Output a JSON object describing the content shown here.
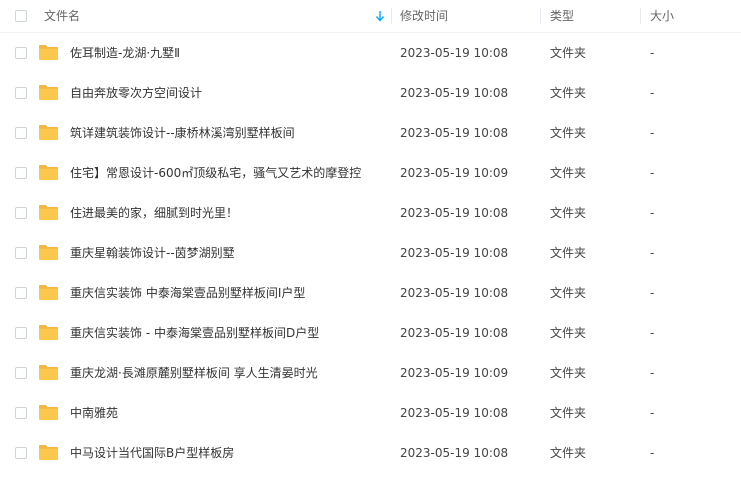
{
  "header": {
    "name_label": "文件名",
    "modified_label": "修改时间",
    "type_label": "类型",
    "size_label": "大小"
  },
  "files": [
    {
      "name": "佐耳制造-龙湖·九墅Ⅱ",
      "modified": "2023-05-19 10:08",
      "type": "文件夹",
      "size": "-"
    },
    {
      "name": "自由奔放零次方空间设计",
      "modified": "2023-05-19 10:08",
      "type": "文件夹",
      "size": "-"
    },
    {
      "name": "筑详建筑装饰设计--康桥林溪湾别墅样板间",
      "modified": "2023-05-19 10:08",
      "type": "文件夹",
      "size": "-"
    },
    {
      "name": "住宅】常恩设计-600㎡顶级私宅，骚气又艺术的摩登控",
      "modified": "2023-05-19 10:09",
      "type": "文件夹",
      "size": "-"
    },
    {
      "name": "住进最美的家，细腻到时光里！",
      "modified": "2023-05-19 10:08",
      "type": "文件夹",
      "size": "-"
    },
    {
      "name": "重庆星翰装饰设计--茵梦湖别墅",
      "modified": "2023-05-19 10:08",
      "type": "文件夹",
      "size": "-"
    },
    {
      "name": "重庆信实装饰  中泰海棠壹品别墅样板间I户型",
      "modified": "2023-05-19 10:08",
      "type": "文件夹",
      "size": "-"
    },
    {
      "name": "重庆信实装饰 - 中泰海棠壹品别墅样板间D户型",
      "modified": "2023-05-19 10:08",
      "type": "文件夹",
      "size": "-"
    },
    {
      "name": "重庆龙湖·長滩原麓别墅样板间 享人生清晏时光",
      "modified": "2023-05-19 10:09",
      "type": "文件夹",
      "size": "-"
    },
    {
      "name": "中南雅苑",
      "modified": "2023-05-19 10:08",
      "type": "文件夹",
      "size": "-"
    },
    {
      "name": "中马设计当代国际B户型样板房",
      "modified": "2023-05-19 10:08",
      "type": "文件夹",
      "size": "-"
    }
  ],
  "icons": {
    "folder": "folder-icon",
    "sort": "sort-down-arrow-icon"
  },
  "colors": {
    "folder": "#fcc74d",
    "accent": "#06a7ff"
  }
}
